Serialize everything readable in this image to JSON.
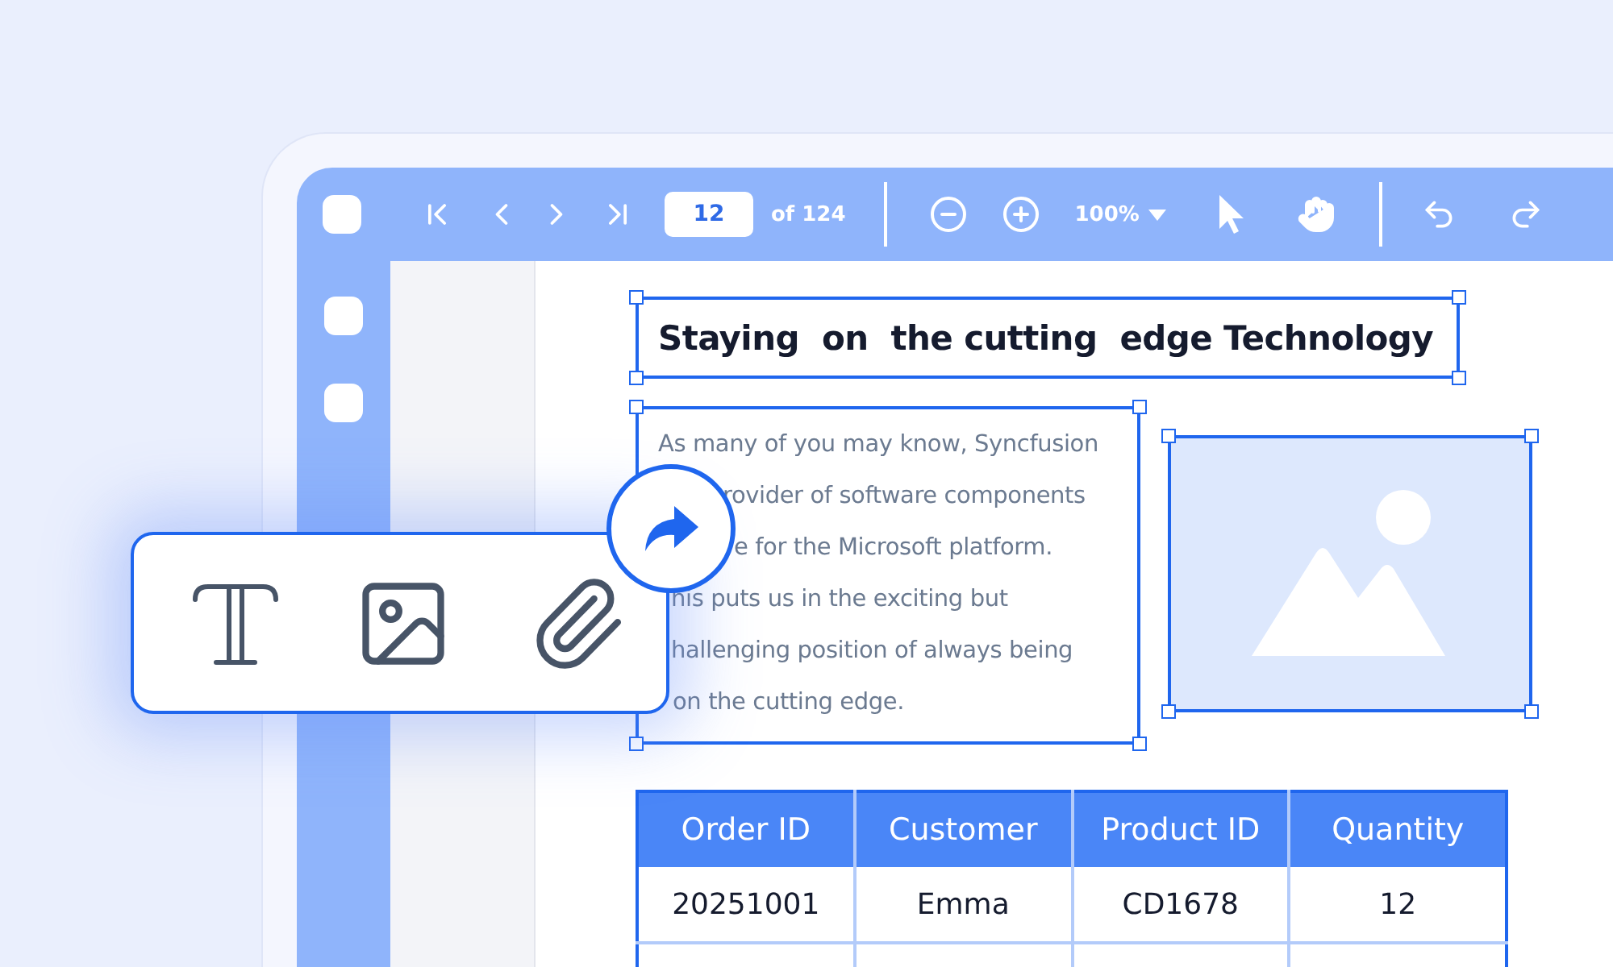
{
  "toolbar": {
    "page_input": {
      "value": "12"
    },
    "page_count": "of 124",
    "zoom": "100%"
  },
  "document": {
    "title": "Staying  on  the cutting  edge Technology",
    "paragraph_lines": [
      "As many of you may know, Syncfusion",
      "rovider of software components",
      "e for the Microsoft platform.",
      "his puts us in the exciting but",
      "hallenging position of always being",
      "on the cutting edge."
    ],
    "table": {
      "columns": [
        "Order ID",
        "Customer",
        "Product ID",
        "Quantity"
      ],
      "rows": [
        [
          "20251001",
          "Emma",
          "CD1678",
          "12"
        ]
      ]
    }
  }
}
